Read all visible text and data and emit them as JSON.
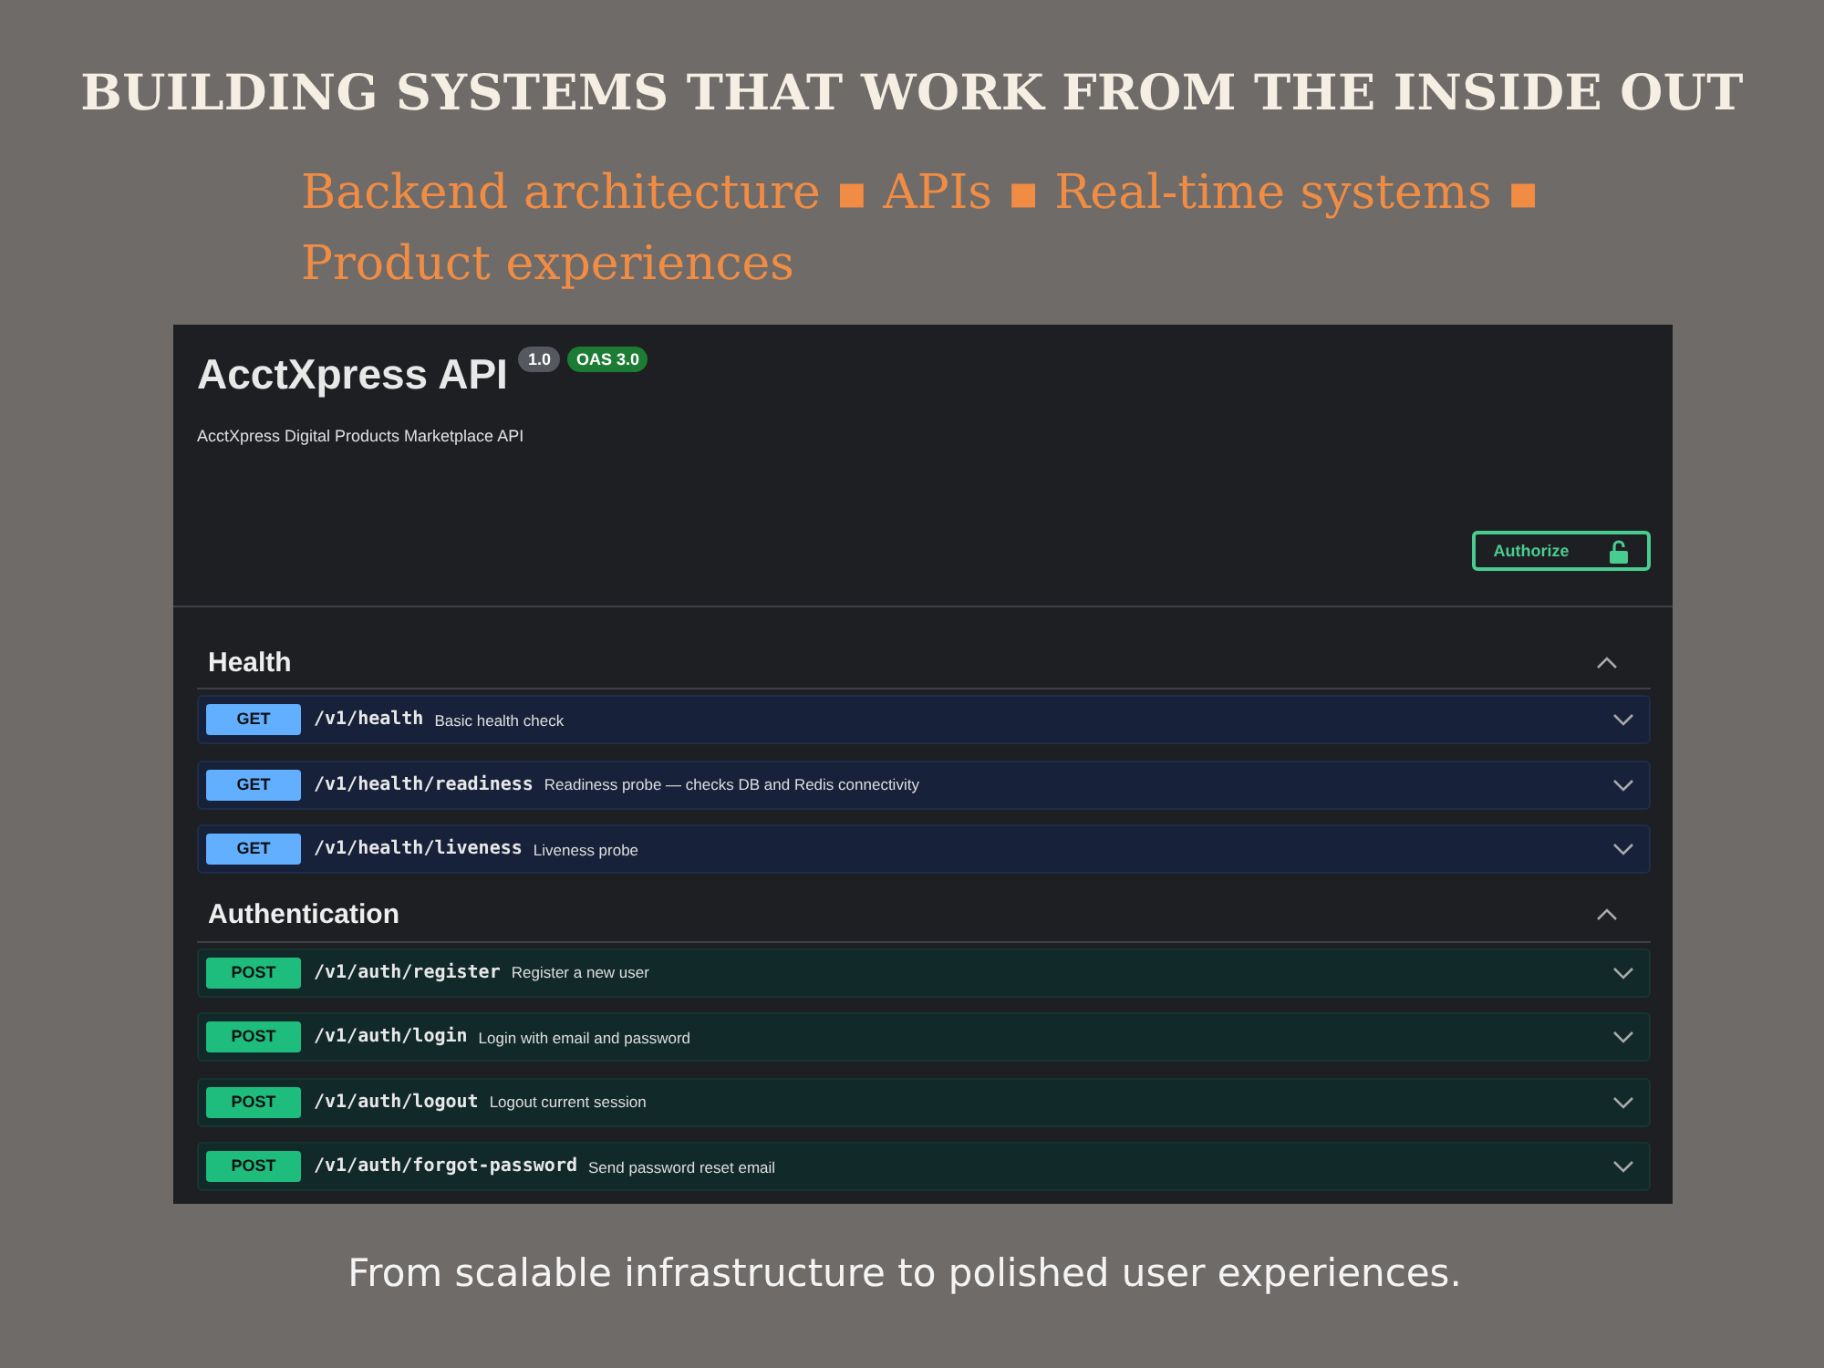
{
  "headline": "BUILDING SYSTEMS THAT WORK FROM THE INSIDE OUT",
  "subheadline": "Backend architecture ▪ APIs ▪ Real-time systems ▪ Product experiences",
  "screenshot": {
    "title": "AcctXpress API",
    "version": "1.0",
    "oas": "OAS 3.0",
    "description": "AcctXpress Digital Products Marketplace API",
    "authorize": "Authorize",
    "sections": [
      {
        "name": "Health",
        "expanded": true,
        "operations": [
          {
            "method": "GET",
            "path": "/v1/health",
            "summary": "Basic health check"
          },
          {
            "method": "GET",
            "path": "/v1/health/readiness",
            "summary": "Readiness probe — checks DB and Redis connectivity"
          },
          {
            "method": "GET",
            "path": "/v1/health/liveness",
            "summary": "Liveness probe"
          }
        ]
      },
      {
        "name": "Authentication",
        "expanded": true,
        "operations": [
          {
            "method": "POST",
            "path": "/v1/auth/register",
            "summary": "Register a new user"
          },
          {
            "method": "POST",
            "path": "/v1/auth/login",
            "summary": "Login with email and password"
          },
          {
            "method": "POST",
            "path": "/v1/auth/logout",
            "summary": "Logout current session"
          },
          {
            "method": "POST",
            "path": "/v1/auth/forgot-password",
            "summary": "Send password reset email"
          }
        ]
      }
    ]
  },
  "caption": "From scalable infrastructure to polished user experiences."
}
